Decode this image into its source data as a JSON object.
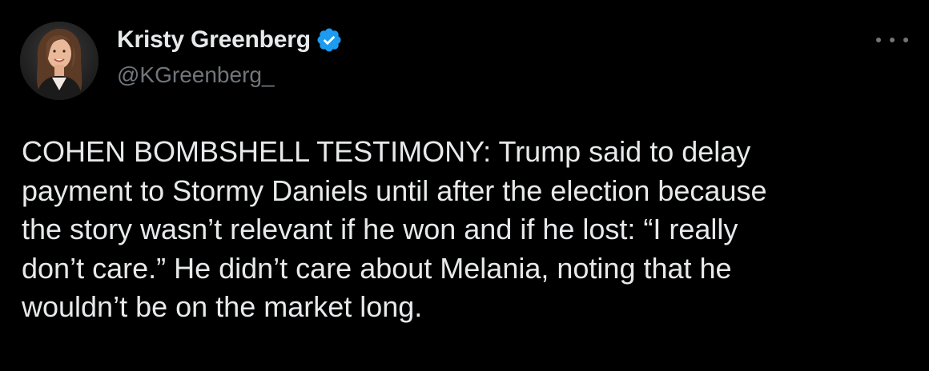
{
  "author": {
    "display_name": "Kristy Greenberg",
    "handle": "@KGreenberg_",
    "verified": true,
    "verified_color": "#1d9bf0"
  },
  "icons": {
    "verified": "verified-badge-icon",
    "more": "more-options-icon"
  },
  "tweet": {
    "lines": [
      "COHEN BOMBSHELL TESTIMONY: Trump said to delay",
      "payment to Stormy Daniels until after the election because",
      "the story wasn’t relevant if he won and if he lost: “I really",
      "don’t care.” He didn’t care about Melania, noting that he",
      "wouldn’t be on the market long."
    ]
  },
  "colors": {
    "background": "#000000",
    "text": "#e7e9ea",
    "secondary": "#71767b"
  }
}
